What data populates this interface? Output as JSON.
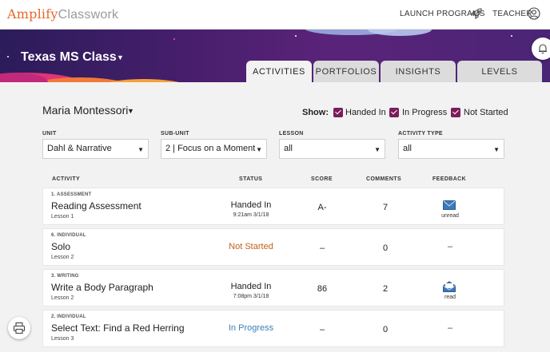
{
  "header": {
    "logo_brand": "Amplify",
    "logo_product": "Classwork",
    "launch_programs": "LAUNCH PROGRAMS",
    "teacher": "TEACHER",
    "icons": [
      "rocket-icon",
      "user-circle-icon"
    ]
  },
  "class": {
    "title": "Texas MS Class"
  },
  "tabs": [
    {
      "label": "ACTIVITIES",
      "active": true
    },
    {
      "label": "PORTFOLIOS",
      "active": false
    },
    {
      "label": "INSIGHTS",
      "active": false
    },
    {
      "label": "LEVELS",
      "active": false
    }
  ],
  "student": {
    "name": "Maria Montessori"
  },
  "show": {
    "label": "Show:",
    "options": [
      {
        "label": "Handed In",
        "checked": true
      },
      {
        "label": "In Progress",
        "checked": true
      },
      {
        "label": "Not Started",
        "checked": true
      }
    ]
  },
  "filters": [
    {
      "label": "UNIT",
      "value": "Dahl & Narrative"
    },
    {
      "label": "SUB-UNIT",
      "value": "2 | Focus on a Moment"
    },
    {
      "label": "LESSON",
      "value": "all"
    },
    {
      "label": "ACTIVITY TYPE",
      "value": "all"
    }
  ],
  "table": {
    "headers": [
      "ACTIVITY",
      "STATUS",
      "SCORE",
      "COMMENTS",
      "FEEDBACK"
    ],
    "rows": [
      {
        "kind": "1. ASSESSMENT",
        "name": "Reading Assessment",
        "lesson": "Lesson 1",
        "status": "Handed In",
        "status_type": "handed",
        "time": "9:21am 3/1/18",
        "score": "A-",
        "comments": "7",
        "feedback": "unread",
        "feedback_icon": "envelope-closed-icon"
      },
      {
        "kind": "6. INDIVIDUAL",
        "name": "Solo",
        "lesson": "Lesson 2",
        "status": "Not Started",
        "status_type": "not",
        "time": "",
        "score": "–",
        "comments": "0",
        "feedback": "–",
        "feedback_icon": ""
      },
      {
        "kind": "3. WRITING",
        "name": "Write a Body Paragraph",
        "lesson": "Lesson 2",
        "status": "Handed In",
        "status_type": "handed",
        "time": "7:08pm 3/1/18",
        "score": "86",
        "comments": "2",
        "feedback": "read",
        "feedback_icon": "envelope-open-icon"
      },
      {
        "kind": "2. INDIVIDUAL",
        "name": "Select Text: Find a Red Herring",
        "lesson": "Lesson 3",
        "status": "In Progress",
        "status_type": "prog",
        "time": "",
        "score": "–",
        "comments": "0",
        "feedback": "–",
        "feedback_icon": ""
      }
    ]
  },
  "colors": {
    "brand_orange": "#e8662c",
    "checkbox": "#7a1d5c",
    "not_started": "#c4601a",
    "in_progress": "#3a7fb8",
    "banner": "#4c1f6f"
  }
}
